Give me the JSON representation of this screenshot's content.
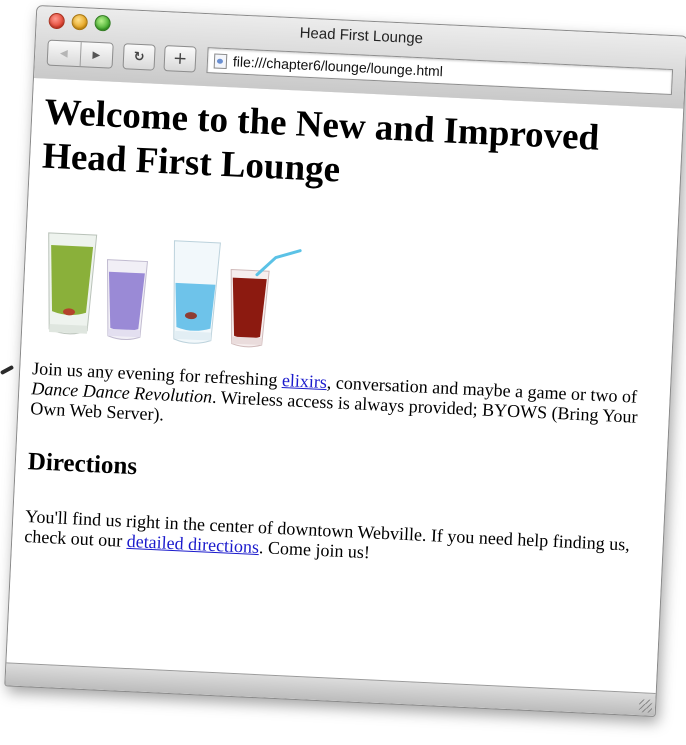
{
  "window": {
    "title": "Head First Lounge",
    "url": "file:///chapter6/lounge/lounge.html",
    "add_label": "+"
  },
  "page": {
    "heading": "Welcome to the New and Improved Head First Lounge",
    "intro": {
      "before_link": "Join us any evening for refreshing ",
      "link": "elixirs",
      "middle": ", conversation and maybe a game or two of ",
      "emphasis": "Dance Dance Revolution",
      "after": ". Wireless access is always provided; BYOWS (Bring Your Own Web Server)."
    },
    "directions": {
      "heading": "Directions",
      "before_link": "You'll find us right in the center of downtown Webville. If you need help finding us, check out our ",
      "link": "detailed directions",
      "after": ". Come join us!"
    }
  },
  "colors": {
    "link": "#1a1acc",
    "drink_green": "#8ab03a",
    "drink_purple": "#9a8ad6",
    "drink_blue": "#6ec3ea",
    "drink_red": "#8c1a10"
  },
  "icons": {
    "back": "back-arrow-icon",
    "forward": "forward-arrow-icon",
    "reload": "reload-icon",
    "add": "plus-icon",
    "page": "document-icon"
  }
}
